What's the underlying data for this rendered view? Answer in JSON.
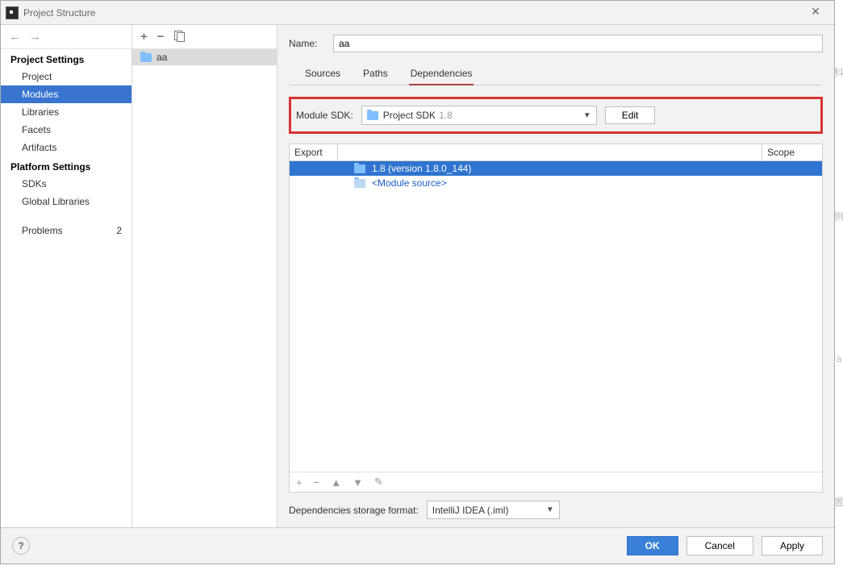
{
  "window": {
    "title": "Project Structure"
  },
  "sidebar": {
    "sections": [
      {
        "title": "Project Settings",
        "items": [
          {
            "label": "Project"
          },
          {
            "label": "Modules",
            "selected": true
          },
          {
            "label": "Libraries"
          },
          {
            "label": "Facets"
          },
          {
            "label": "Artifacts"
          }
        ]
      },
      {
        "title": "Platform Settings",
        "items": [
          {
            "label": "SDKs"
          },
          {
            "label": "Global Libraries"
          }
        ]
      }
    ],
    "problems": {
      "label": "Problems",
      "badge": "2"
    }
  },
  "modules": {
    "items": [
      {
        "name": "aa"
      }
    ]
  },
  "right": {
    "name_label": "Name:",
    "name_value": "aa",
    "tabs": [
      {
        "label": "Sources"
      },
      {
        "label": "Paths"
      },
      {
        "label": "Dependencies",
        "active": true
      }
    ],
    "module_sdk_label": "Module SDK:",
    "module_sdk_text": "Project SDK",
    "module_sdk_version": "1.8",
    "edit_label": "Edit",
    "dep_headers": {
      "export": "Export",
      "scope": "Scope"
    },
    "dep_rows": [
      {
        "label": "1.8 (version 1.8.0_144)",
        "selected": true
      },
      {
        "label": "<Module source>",
        "link": true
      }
    ],
    "storage_label": "Dependencies storage format:",
    "storage_value": "IntelliJ IDEA (.iml)"
  },
  "footer": {
    "ok": "OK",
    "cancel": "Cancel",
    "apply": "Apply"
  }
}
